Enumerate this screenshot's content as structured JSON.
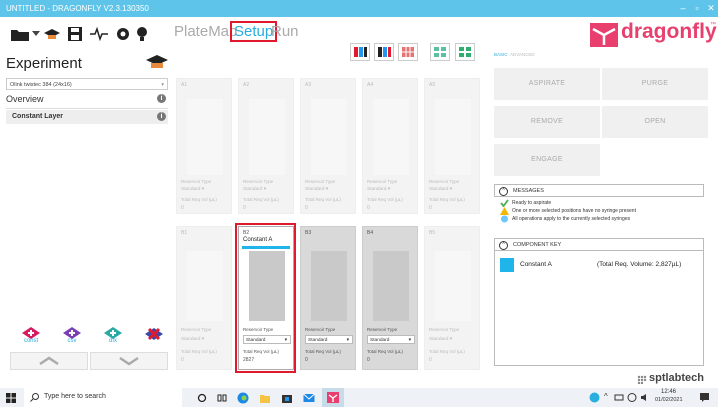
{
  "window": {
    "title": "UNTITLED - DRAGONFLY V2.3.130350",
    "minimize": "–",
    "maximize": "▫",
    "close": "✕"
  },
  "nav": {
    "platemap": "PlateMap",
    "setup": "Setup",
    "run": "Run"
  },
  "logo": {
    "text": "dragonfly",
    "tm": "™"
  },
  "experiment": {
    "title": "Experiment",
    "plate": "Olink twistec 384 (24x16)",
    "overview": "Overview",
    "layer": "Constant Layer"
  },
  "buttons": {
    "const": "const",
    "csv": "csv",
    "dfx": "dfx"
  },
  "tabs": {
    "basic": "BASIC",
    "advanced": "ADVANCED"
  },
  "actions": {
    "aspirate": "ASPIRATE",
    "purge": "PURGE",
    "remove": "REMOVE",
    "open": "OPEN",
    "engage": "ENGAGE"
  },
  "messages": {
    "header": "MESSAGES",
    "items": [
      {
        "text": "Ready to aspirate",
        "icon": "check-icon",
        "color": "#4caf50"
      },
      {
        "text": "One or more selected positions have no syringe present",
        "icon": "warning-icon",
        "color": "#f5b800"
      },
      {
        "text": "All operations apply to the currently selected syringes",
        "icon": "info-icon",
        "color": "#6ec6ff"
      }
    ]
  },
  "component_key": {
    "header": "COMPONENT KEY",
    "name": "Constant A",
    "volume": "(Total Req. Volume:  2,827µL)",
    "color": "#20b5ea"
  },
  "reservoir_labels": {
    "type": "Reservoir Type",
    "type_value": "Standard",
    "vol": "Total Req Vol (µL)"
  },
  "reservoirs_top": [
    {
      "id": "A1",
      "value": "0"
    },
    {
      "id": "A2",
      "value": "0"
    },
    {
      "id": "A3",
      "value": "0"
    },
    {
      "id": "A4",
      "value": "0"
    },
    {
      "id": "A5",
      "value": "0"
    }
  ],
  "reservoirs_bottom": [
    {
      "id": "B1",
      "value": "0",
      "name": ""
    },
    {
      "id": "B2",
      "value": "2827",
      "name": "Constant A"
    },
    {
      "id": "B3",
      "value": "0",
      "name": ""
    },
    {
      "id": "B4",
      "value": "0",
      "name": ""
    },
    {
      "id": "B5",
      "value": "0",
      "name": ""
    }
  ],
  "brand": {
    "text": "sptlabtech"
  },
  "taskbar": {
    "search": "Type here to search",
    "time": "12:46",
    "date": "01/02/2021"
  },
  "colors": {
    "accent": "#5fc4e9",
    "highlight": "#e0192f",
    "logo": "#e83f6f"
  }
}
